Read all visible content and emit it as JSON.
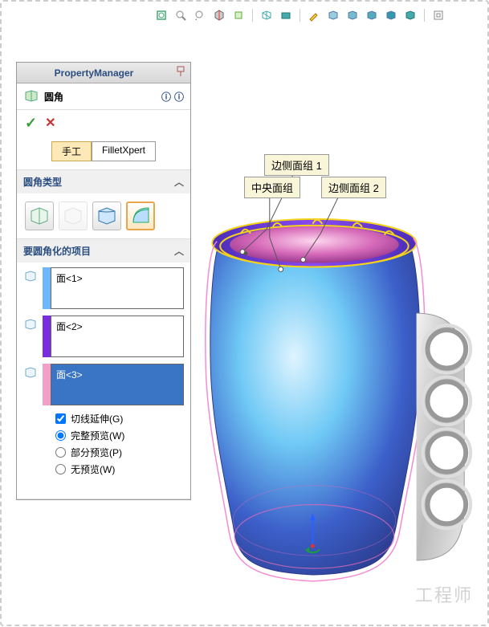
{
  "toolbar": {
    "items": [
      "zoom-fit",
      "zoom-area",
      "zoom-prev",
      "section",
      "front",
      "isometric",
      "display",
      "edit",
      "shade1",
      "shade2",
      "shade3",
      "shade4",
      "shade5",
      "perspective"
    ]
  },
  "panel": {
    "title": "PropertyManager",
    "command": {
      "label": "圆角",
      "help1": "?",
      "help2": "?"
    },
    "okLabel": "✓",
    "cancelLabel": "✕",
    "tabs": {
      "manual": "手工",
      "expert": "FilletXpert"
    },
    "sections": {
      "type": {
        "title": "圆角类型",
        "caret": "︿"
      },
      "items": {
        "title": "要圆角化的项目",
        "caret": "︿"
      }
    },
    "faces": {
      "f1": {
        "label": "面<1>",
        "color": "#6db7ff"
      },
      "f2": {
        "label": "面<2>",
        "color": "#7a2de0"
      },
      "f3": {
        "label": "面<3>",
        "color": "#f3a0c8"
      }
    },
    "options": {
      "tangent": "切线延伸(G)",
      "full": "完整预览(W)",
      "partial": "部分预览(P)",
      "none": "无预览(W)"
    }
  },
  "callouts": {
    "side1": "边侧面组 1",
    "center": "中央面组",
    "side2": "边侧面组 2"
  },
  "watermark": "工程师",
  "chart_data": {
    "type": "other",
    "description": "SolidWorks Fillet PropertyManager panel screenshot; no chart data."
  }
}
